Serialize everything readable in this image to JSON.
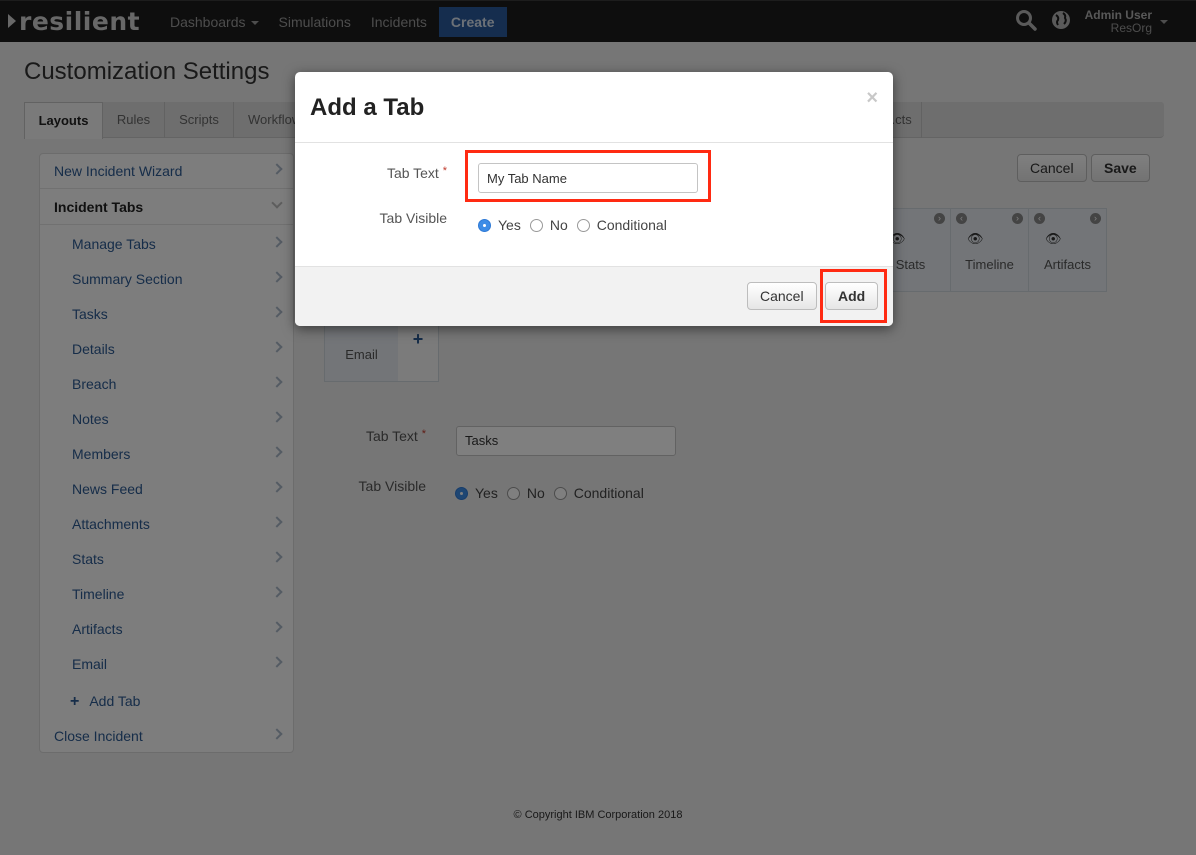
{
  "topnav": {
    "logo": "resilient",
    "links": [
      {
        "label": "Dashboards",
        "has_caret": true
      },
      {
        "label": "Simulations"
      },
      {
        "label": "Incidents"
      }
    ],
    "create_label": "Create",
    "icons": [
      "search-icon",
      "globe-icon"
    ],
    "user": {
      "name": "Admin User",
      "org": "ResOrg"
    }
  },
  "page": {
    "title": "Customization Settings",
    "tabs": [
      {
        "label": "Layouts",
        "active": true
      },
      {
        "label": "Rules"
      },
      {
        "label": "Scripts"
      },
      {
        "label": "Workflows"
      },
      {
        "label": "...cts"
      }
    ]
  },
  "sidebar": {
    "top_items": [
      {
        "label": "New Incident Wizard"
      },
      {
        "label": "Incident Tabs",
        "expanded": true
      },
      {
        "label": "Close Incident"
      }
    ],
    "sub_items": [
      {
        "label": "Manage Tabs"
      },
      {
        "label": "Summary Section"
      },
      {
        "label": "Tasks"
      },
      {
        "label": "Details"
      },
      {
        "label": "Breach"
      },
      {
        "label": "Notes"
      },
      {
        "label": "Members"
      },
      {
        "label": "News Feed"
      },
      {
        "label": "Attachments"
      },
      {
        "label": "Stats"
      },
      {
        "label": "Timeline"
      },
      {
        "label": "Artifacts"
      },
      {
        "label": "Email"
      }
    ],
    "add_tab_label": "Add Tab"
  },
  "main": {
    "cancel_label": "Cancel",
    "save_label": "Save",
    "tiles": [
      {
        "label": "Stats"
      },
      {
        "label": "Timeline"
      },
      {
        "label": "Artifacts"
      },
      {
        "label": "Email"
      }
    ],
    "form": {
      "tab_text_label": "Tab Text",
      "tab_text_value": "Tasks",
      "tab_visible_label": "Tab Visible",
      "visible_options": [
        "Yes",
        "No",
        "Conditional"
      ],
      "visible_selected": "Yes"
    }
  },
  "modal": {
    "title": "Add a Tab",
    "close_glyph": "×",
    "tab_text_label": "Tab Text",
    "required_mark": "*",
    "tab_text_value": "My Tab Name",
    "tab_visible_label": "Tab Visible",
    "visible_options": [
      "Yes",
      "No",
      "Conditional"
    ],
    "visible_selected": "Yes",
    "cancel_label": "Cancel",
    "add_label": "Add",
    "highlight_color": "#ff2a12"
  },
  "footer": {
    "copyright": "© Copyright IBM Corporation 2018"
  },
  "colors": {
    "accent": "#2a5a9c",
    "link": "#2c5a93",
    "radio_selected": "#3d8ce6"
  }
}
